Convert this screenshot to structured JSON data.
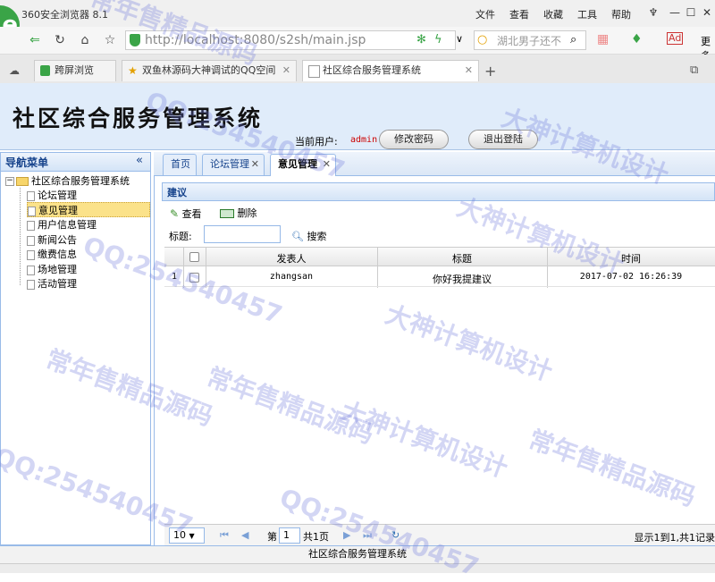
{
  "browser": {
    "title": "360安全浏览器 8.1",
    "menu": [
      "文件",
      "查看",
      "收藏",
      "工具",
      "帮助"
    ],
    "window_controls": {
      "minimize": "—",
      "maximize": "☐",
      "close": "✕"
    },
    "url": "http://localhost:8080/s2sh/main.jsp",
    "search_placeholder": "湖北男子还不",
    "extra_label": "更多",
    "tabs": [
      {
        "label": "跨屏浏览"
      },
      {
        "label": "双鱼林源码大神调试的QQ空间"
      },
      {
        "label": "社区综合服务管理系统"
      }
    ],
    "new_tab": "+"
  },
  "header": {
    "title": "社区综合服务管理系统",
    "current_user_label": "当前用户:",
    "current_user": "admin",
    "change_password": "修改密码",
    "logout": "退出登陆"
  },
  "nav": {
    "title": "导航菜单",
    "collapse": "«",
    "root": "社区综合服务管理系统",
    "items": [
      "论坛管理",
      "意见管理",
      "用户信息管理",
      "新闻公告",
      "缴费信息",
      "场地管理",
      "活动管理"
    ]
  },
  "main_tabs": [
    {
      "label": "首页"
    },
    {
      "label": "论坛管理"
    },
    {
      "label": "意见管理"
    }
  ],
  "panel": {
    "title": "建议",
    "view": "查看",
    "delete": "删除",
    "search_label": "标题:",
    "search_value": "",
    "search_button": "搜索"
  },
  "grid": {
    "columns": [
      "发表人",
      "标题",
      "时间"
    ],
    "rows": [
      {
        "index": "1",
        "author": "zhangsan",
        "title": "你好我提建议",
        "time": "2017-07-02 16:26:39"
      }
    ]
  },
  "pager": {
    "page_size": "10",
    "page_prefix": "第",
    "page": "1",
    "page_total": "共1页",
    "info": "显示1到1,共1记录"
  },
  "footer": "社区综合服务管理系统",
  "watermark": {
    "texts": [
      "常年售精品源码",
      "QQ:254540457",
      "大神计算机设计",
      "常年售精品源码",
      "QQ:254540457",
      "大神计算机设计",
      "QQ:254540457",
      "大神计算机设计",
      "常年售精品源码",
      "QQ:254540457",
      "大神计算机设计",
      "常年售精品源码"
    ]
  }
}
